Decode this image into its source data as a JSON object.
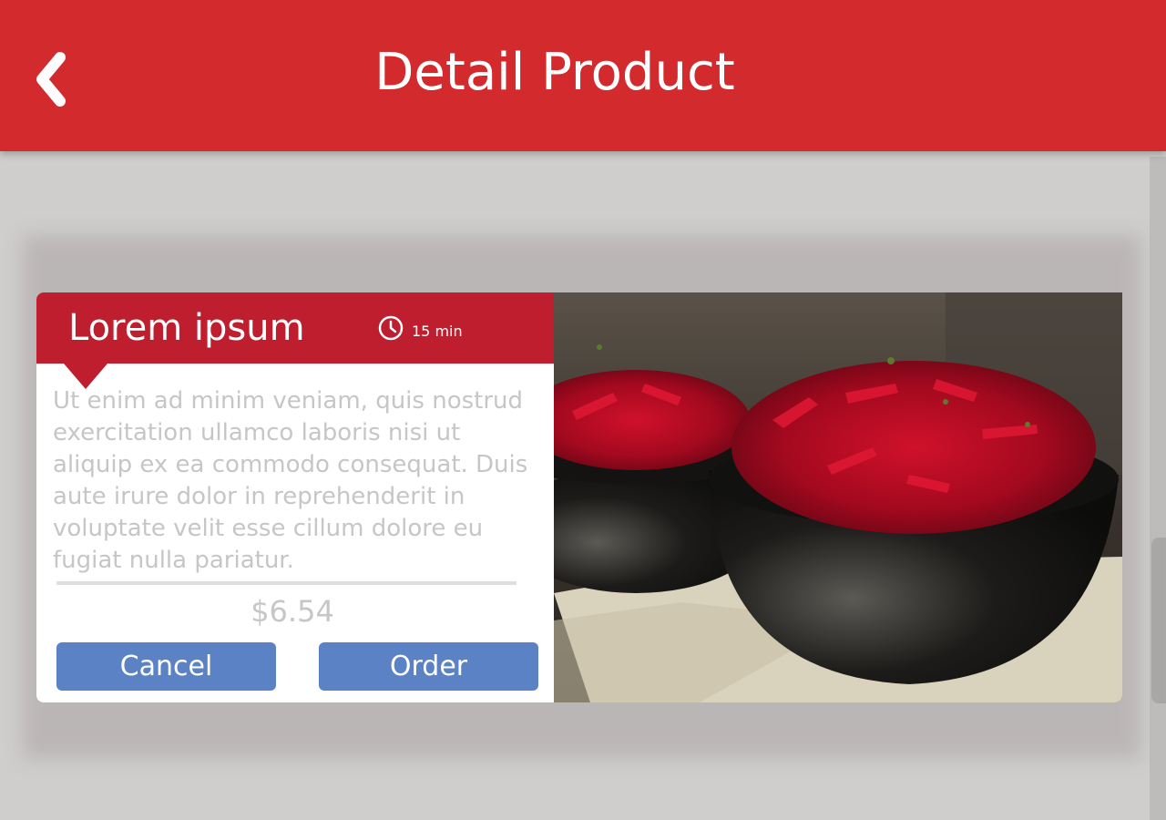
{
  "header": {
    "title": "Detail Product",
    "back_icon": "chevron-left-icon",
    "background": "#d32a2d"
  },
  "product": {
    "name": "Lorem ipsum",
    "time_icon": "clock-icon",
    "prep_time": "15 min",
    "description": "Ut enim ad minim veniam, quis nostrud exercitation ullamco laboris nisi ut aliquip ex ea commodo consequat. Duis aute irure dolor in reprehenderit in voluptate velit esse cillum dolore eu fugiat nulla pariatur.",
    "price": "$6.54",
    "header_color": "#be1e2d"
  },
  "actions": {
    "cancel_label": "Cancel",
    "order_label": "Order",
    "button_color": "#5b82c4"
  }
}
